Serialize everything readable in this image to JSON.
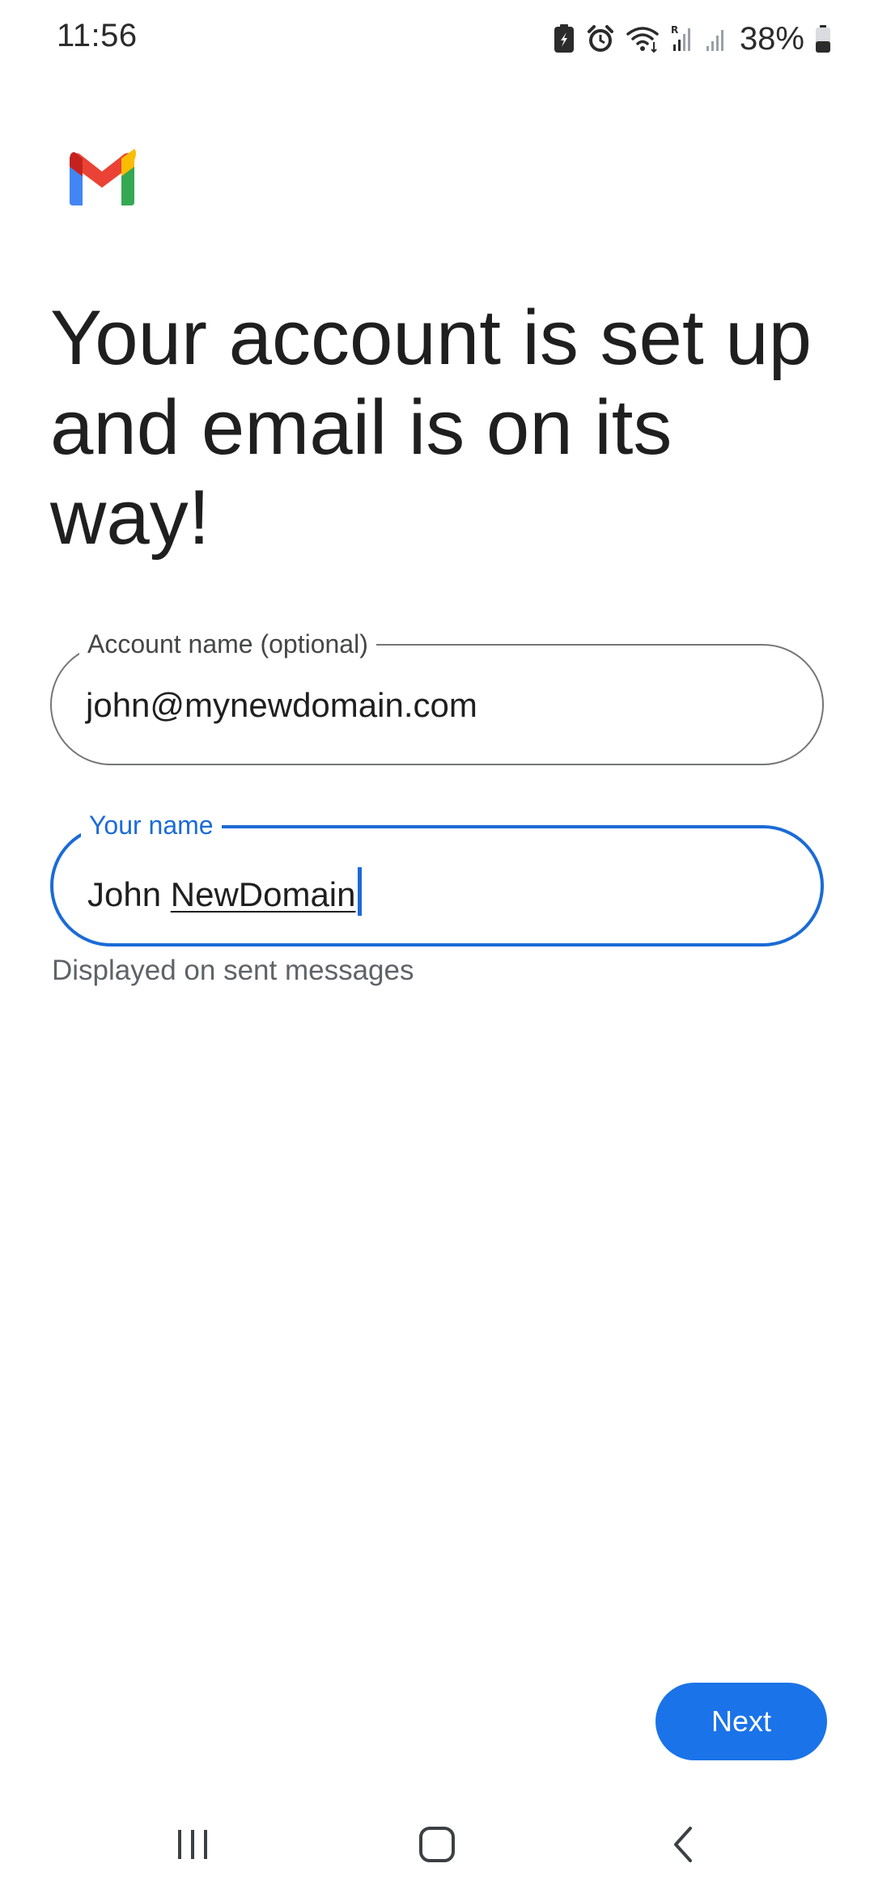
{
  "status_bar": {
    "time": "11:56",
    "battery_percent": "38%",
    "icons": [
      "battery-saver-icon",
      "alarm-icon",
      "wifi-icon",
      "roaming-signal-icon",
      "signal-icon",
      "battery-icon"
    ]
  },
  "app": {
    "logo": "gmail-logo"
  },
  "title": "Your account is set up and email is on its way!",
  "account_field": {
    "label": "Account name (optional)",
    "value": "john@mynewdomain.com"
  },
  "name_field": {
    "label": "Your name",
    "value_first": "John",
    "value_last": "NewDomain",
    "helper": "Displayed on sent messages"
  },
  "next_button": {
    "label": "Next"
  },
  "nav_bar": {
    "icons": [
      "recents-icon",
      "home-icon",
      "back-icon"
    ]
  },
  "colors": {
    "accent": "#1a73e8",
    "focused_outline": "#1b6bd6",
    "outline": "#747775",
    "text_primary": "#1f1f1f",
    "text_secondary": "#5f6368"
  }
}
